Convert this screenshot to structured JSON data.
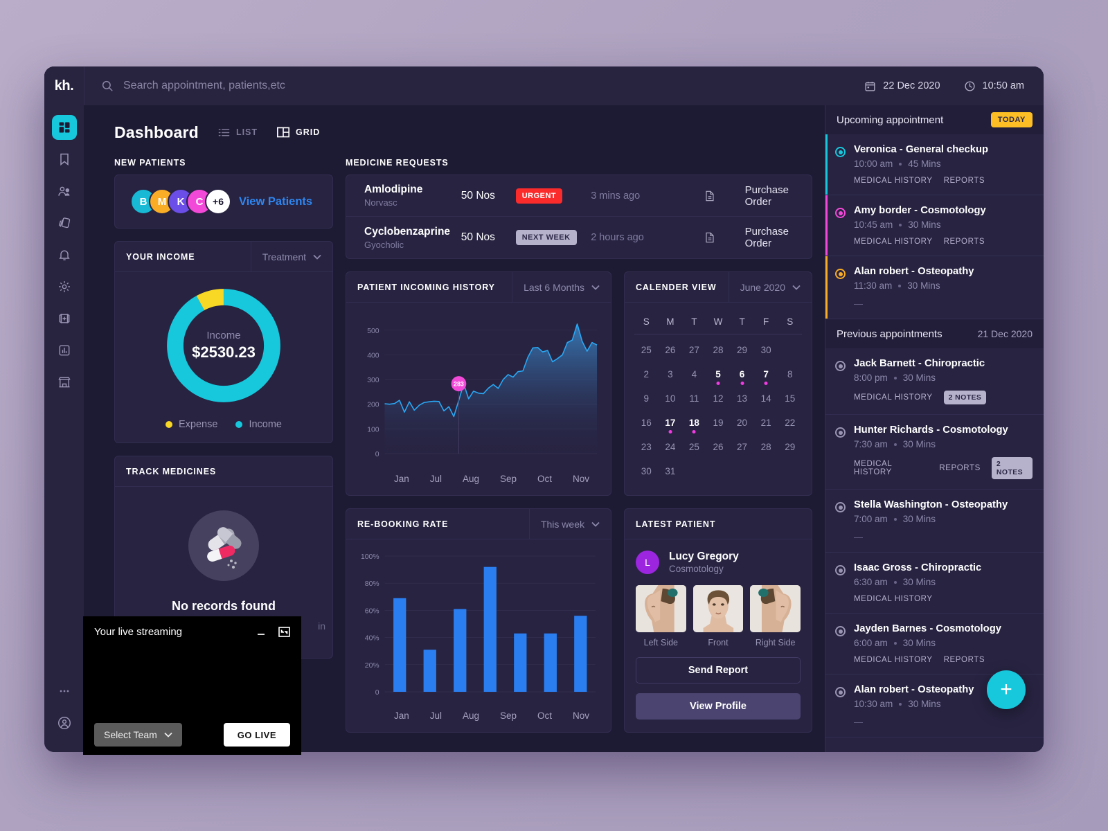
{
  "app": {
    "logo": "kh."
  },
  "search": {
    "placeholder": "Search appointment, patients,etc",
    "value": ""
  },
  "header": {
    "date": "22 Dec 2020",
    "time": "10:50 am"
  },
  "rail": {
    "items": [
      {
        "name": "dashboard",
        "icon": "grid-icon",
        "active": true
      },
      {
        "name": "bookmarks",
        "icon": "bookmark-icon",
        "active": false
      },
      {
        "name": "patients",
        "icon": "users-icon",
        "active": false
      },
      {
        "name": "cards",
        "icon": "layers-icon",
        "active": false
      },
      {
        "name": "notifications",
        "icon": "bell-icon",
        "active": false
      },
      {
        "name": "settings",
        "icon": "gear-icon",
        "active": false
      },
      {
        "name": "medical",
        "icon": "first-aid-icon",
        "active": false
      },
      {
        "name": "reports",
        "icon": "bar-chart-icon",
        "active": false
      },
      {
        "name": "pharmacy",
        "icon": "store-icon",
        "active": false
      }
    ],
    "more": "more-icon",
    "account": "account-icon"
  },
  "page": {
    "title": "Dashboard",
    "view_list": "LIST",
    "view_grid": "GRID"
  },
  "new_patients": {
    "label": "NEW PATIENTS",
    "avatars": [
      {
        "initial": "B",
        "color": "#17b9d4"
      },
      {
        "initial": "M",
        "color": "#f9ad26"
      },
      {
        "initial": "K",
        "color": "#6b4ee8"
      },
      {
        "initial": "C",
        "color": "#f349d8"
      }
    ],
    "more_count": "+6",
    "view_link": "View Patients"
  },
  "income": {
    "title": "YOUR INCOME",
    "filter": "Treatment",
    "center_label": "Income",
    "center_value": "$2530.23",
    "legend": [
      {
        "label": "Expense",
        "color": "#f8d725"
      },
      {
        "label": "Income",
        "color": "#17c8dd"
      }
    ]
  },
  "track_medicines": {
    "title": "TRACK MEDICINES",
    "empty_text": "No records found",
    "empty_sub": "in"
  },
  "medicine_requests": {
    "label": "MEDICINE REQUESTS",
    "rows": [
      {
        "name": "Amlodipine",
        "brand": "Norvasc",
        "qty": "50 Nos",
        "badge": "URGENT",
        "badge_type": "urgent",
        "time": "3 mins ago",
        "action": "Purchase Order"
      },
      {
        "name": "Cyclobenzaprine",
        "brand": "Gyocholic",
        "qty": "50 Nos",
        "badge": "NEXT WEEK",
        "badge_type": "next",
        "time": "2 hours ago",
        "action": "Purchase Order"
      }
    ]
  },
  "calendar": {
    "title": "CALENDER VIEW",
    "month": "June 2020",
    "dow": [
      "S",
      "M",
      "T",
      "W",
      "T",
      "F",
      "S"
    ],
    "weeks": [
      [
        {
          "d": "25",
          "cur": false,
          "mark": false
        },
        {
          "d": "26",
          "cur": false,
          "mark": false
        },
        {
          "d": "27",
          "cur": false,
          "mark": false
        },
        {
          "d": "28",
          "cur": false,
          "mark": false
        },
        {
          "d": "29",
          "cur": false,
          "mark": false
        },
        {
          "d": "30",
          "cur": false,
          "mark": false
        },
        {
          "d": "",
          "cur": false,
          "mark": false
        }
      ],
      [
        {
          "d": "2",
          "cur": false,
          "mark": false
        },
        {
          "d": "3",
          "cur": false,
          "mark": false
        },
        {
          "d": "4",
          "cur": false,
          "mark": false
        },
        {
          "d": "5",
          "cur": true,
          "mark": true
        },
        {
          "d": "6",
          "cur": true,
          "mark": true
        },
        {
          "d": "7",
          "cur": true,
          "mark": true
        },
        {
          "d": "8",
          "cur": false,
          "mark": false
        }
      ],
      [
        {
          "d": "9",
          "cur": false,
          "mark": false
        },
        {
          "d": "10",
          "cur": false,
          "mark": false
        },
        {
          "d": "11",
          "cur": false,
          "mark": false
        },
        {
          "d": "12",
          "cur": false,
          "mark": false
        },
        {
          "d": "13",
          "cur": false,
          "mark": false
        },
        {
          "d": "14",
          "cur": false,
          "mark": false
        },
        {
          "d": "15",
          "cur": false,
          "mark": false
        }
      ],
      [
        {
          "d": "16",
          "cur": false,
          "mark": false
        },
        {
          "d": "17",
          "cur": true,
          "mark": true
        },
        {
          "d": "18",
          "cur": true,
          "mark": true
        },
        {
          "d": "19",
          "cur": false,
          "mark": false
        },
        {
          "d": "20",
          "cur": false,
          "mark": false
        },
        {
          "d": "21",
          "cur": false,
          "mark": false
        },
        {
          "d": "22",
          "cur": false,
          "mark": false
        }
      ],
      [
        {
          "d": "23",
          "cur": false,
          "mark": false
        },
        {
          "d": "24",
          "cur": false,
          "mark": false
        },
        {
          "d": "25",
          "cur": false,
          "mark": false
        },
        {
          "d": "26",
          "cur": false,
          "mark": false
        },
        {
          "d": "27",
          "cur": false,
          "mark": false
        },
        {
          "d": "28",
          "cur": false,
          "mark": false
        },
        {
          "d": "29",
          "cur": false,
          "mark": false
        }
      ],
      [
        {
          "d": "30",
          "cur": false,
          "mark": false
        },
        {
          "d": "31",
          "cur": false,
          "mark": false
        },
        {
          "d": "",
          "cur": false,
          "mark": false
        },
        {
          "d": "",
          "cur": false,
          "mark": false
        },
        {
          "d": "",
          "cur": false,
          "mark": false
        },
        {
          "d": "",
          "cur": false,
          "mark": false
        },
        {
          "d": "",
          "cur": false,
          "mark": false
        }
      ]
    ]
  },
  "latest_patient": {
    "title": "LATEST PATIENT",
    "avatar_initial": "L",
    "name": "Lucy Gregory",
    "specialty": "Cosmotology",
    "thumbs": [
      {
        "caption": "Left Side"
      },
      {
        "caption": "Front"
      },
      {
        "caption": "Right Side"
      }
    ],
    "send_report": "Send Report",
    "view_profile": "View Profile"
  },
  "right_panel": {
    "upcoming_title": "Upcoming appointment",
    "today_badge": "TODAY",
    "upcoming": [
      {
        "name": "Veronica - General checkup",
        "time": "10:00 am",
        "duration": "45 Mins",
        "links": [
          "MEDICAL HISTORY",
          "REPORTS"
        ],
        "notes": "",
        "color": "#17c8dd",
        "dash": false
      },
      {
        "name": "Amy border - Cosmotology",
        "time": "10:45 am",
        "duration": "30 Mins",
        "links": [
          "MEDICAL HISTORY",
          "REPORTS"
        ],
        "notes": "",
        "color": "#f349d8",
        "dash": false
      },
      {
        "name": "Alan robert - Osteopathy",
        "time": "11:30 am",
        "duration": "30 Mins",
        "links": [],
        "notes": "",
        "color": "#f9ad26",
        "dash": true
      }
    ],
    "previous_title": "Previous appointments",
    "previous_date": "21 Dec 2020",
    "previous": [
      {
        "name": "Jack Barnett - Chiropractic",
        "time": "8:00 pm",
        "duration": "30 Mins",
        "links": [
          "MEDICAL HISTORY"
        ],
        "notes": "2 NOTES",
        "dash": false
      },
      {
        "name": "Hunter Richards - Cosmotology",
        "time": "7:30 am",
        "duration": "30 Mins",
        "links": [
          "MEDICAL HISTORY",
          "REPORTS"
        ],
        "notes": "2 NOTES",
        "dash": false
      },
      {
        "name": "Stella Washington - Osteopathy",
        "time": "7:00 am",
        "duration": "30 Mins",
        "links": [],
        "notes": "",
        "dash": true
      },
      {
        "name": "Isaac Gross - Chiropractic",
        "time": "6:30 am",
        "duration": "30 Mins",
        "links": [
          "MEDICAL HISTORY"
        ],
        "notes": "",
        "dash": false
      },
      {
        "name": "Jayden Barnes - Cosmotology",
        "time": "6:00 am",
        "duration": "30 Mins",
        "links": [
          "MEDICAL HISTORY",
          "REPORTS"
        ],
        "notes": "",
        "dash": false
      },
      {
        "name": "Alan robert - Osteopathy",
        "time": "10:30 am",
        "duration": "30 Mins",
        "links": [],
        "notes": "",
        "dash": true
      }
    ],
    "add_button": "+"
  },
  "stream": {
    "title": "Your live streaming",
    "minimize": "minimize-icon",
    "expand": "expand-icon",
    "select_team": "Select Team",
    "go_live": "GO LIVE"
  },
  "chart_data": [
    {
      "type": "pie",
      "title": "YOUR INCOME",
      "labels": [
        "Income",
        "Expense"
      ],
      "values": [
        92,
        8
      ],
      "colors": [
        "#17c8dd",
        "#f8d725"
      ],
      "center_label": "Income",
      "center_value": "$2530.23",
      "legend_position": "bottom"
    },
    {
      "type": "area",
      "title": "PATIENT INCOMING HISTORY",
      "range_filter": "Last 6 Months",
      "xlabel": "",
      "ylabel": "",
      "ylim": [
        0,
        550
      ],
      "yticks": [
        500,
        400,
        300,
        200,
        100,
        0
      ],
      "categories": [
        "Jan",
        "Jul",
        "Aug",
        "Sep",
        "Oct",
        "Nov"
      ],
      "grid": true,
      "line_color": "#29a8f5",
      "annotation": {
        "label": "283",
        "x_index": 15,
        "value": 283,
        "color": "#f349d8"
      },
      "values": [
        202,
        200,
        203,
        216,
        168,
        210,
        176,
        196,
        207,
        210,
        212,
        211,
        173,
        190,
        150,
        215,
        283,
        222,
        253,
        245,
        243,
        265,
        280,
        264,
        300,
        320,
        310,
        332,
        335,
        390,
        428,
        430,
        412,
        418,
        372,
        385,
        400,
        450,
        460,
        525,
        455,
        415,
        450,
        440
      ]
    },
    {
      "type": "bar",
      "title": "RE-BOOKING RATE",
      "range_filter": "This week",
      "xlabel": "",
      "ylabel": "",
      "ylim": [
        0,
        100
      ],
      "yticks": [
        "100%",
        "80%",
        "60%",
        "40%",
        "20%",
        "0"
      ],
      "categories": [
        "Jan",
        "Jul",
        "Aug",
        "Sep",
        "Oct",
        "Nov",
        ""
      ],
      "values": [
        69,
        31,
        61,
        92,
        43,
        43,
        56
      ],
      "bar_color": "#2b7ef0",
      "grid": true
    }
  ]
}
